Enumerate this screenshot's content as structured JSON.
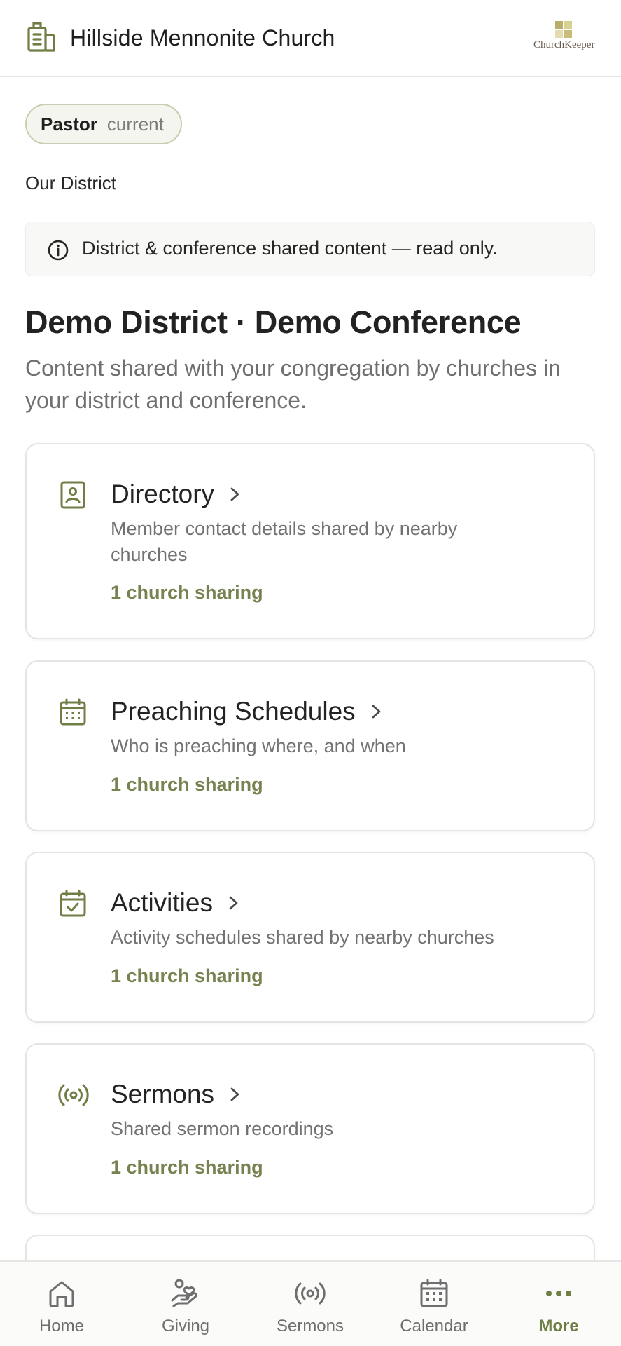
{
  "header": {
    "title": "Hillside Mennonite Church",
    "logo_text": "ChurchKeeper"
  },
  "role": {
    "name": "Pastor",
    "status": "current"
  },
  "section_label": "Our District",
  "notice": {
    "icon": "info-icon",
    "text": "District & conference shared content — read only."
  },
  "main": {
    "heading": "Demo District · Demo Conference",
    "subheading": "Content shared with your congregation by churches in your district and conference."
  },
  "cards": [
    {
      "icon": "contact-book-icon",
      "title": "Directory",
      "description": "Member contact details shared by nearby churches",
      "meta": "1 church sharing"
    },
    {
      "icon": "calendar-grid-icon",
      "title": "Preaching Schedules",
      "description": "Who is preaching where, and when",
      "meta": "1 church sharing"
    },
    {
      "icon": "calendar-check-icon",
      "title": "Activities",
      "description": "Activity schedules shared by nearby churches",
      "meta": "1 church sharing"
    },
    {
      "icon": "broadcast-icon",
      "title": "Sermons",
      "description": "Shared sermon recordings",
      "meta": "1 church sharing"
    }
  ],
  "nav": {
    "items": [
      {
        "label": "Home",
        "icon": "home-icon"
      },
      {
        "label": "Giving",
        "icon": "giving-hand-icon"
      },
      {
        "label": "Sermons",
        "icon": "broadcast-icon"
      },
      {
        "label": "Calendar",
        "icon": "calendar-icon"
      },
      {
        "label": "More",
        "icon": "more-dots-icon"
      }
    ],
    "active": "More"
  },
  "colors": {
    "accent": "#6f7e45",
    "meta_text": "#768350",
    "pill_border": "#c7cdb0"
  }
}
